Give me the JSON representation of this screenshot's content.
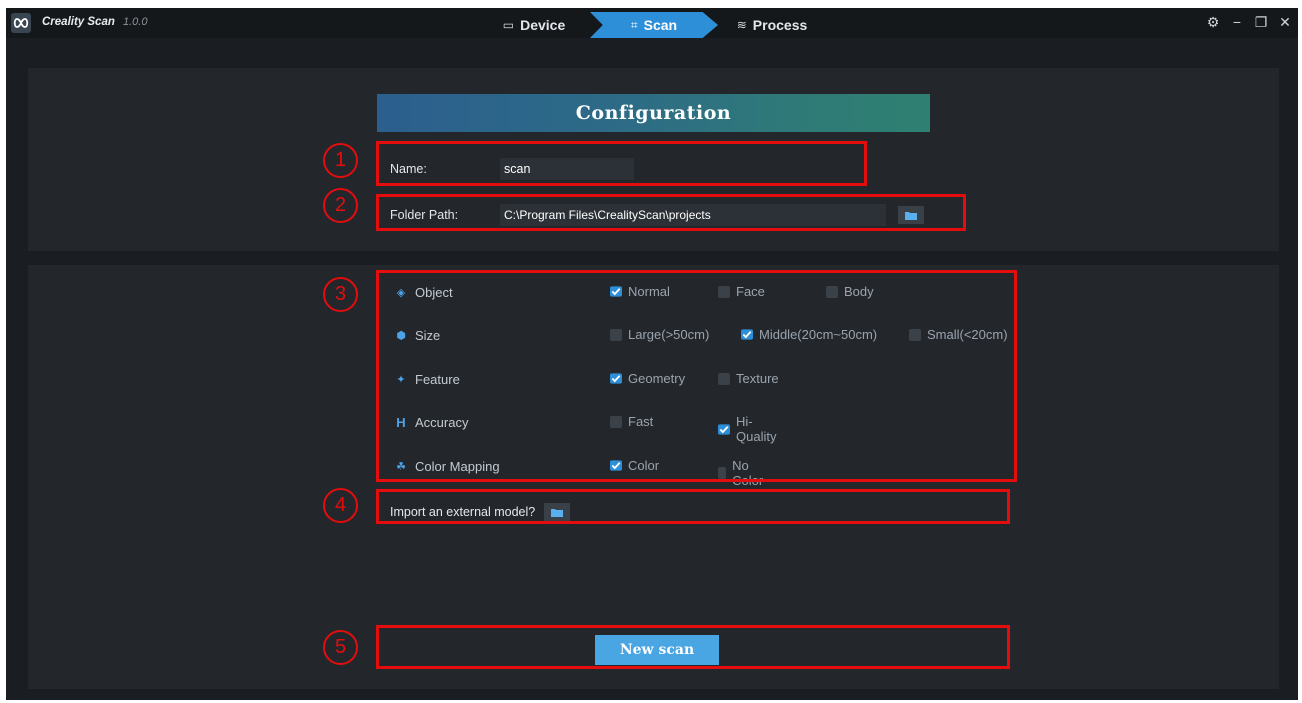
{
  "app": {
    "name": "Creality Scan",
    "version": "1.0.0"
  },
  "tabs": [
    {
      "label": "Device",
      "icon": "device-icon",
      "active": false
    },
    {
      "label": "Scan",
      "icon": "scan-icon",
      "active": true
    },
    {
      "label": "Process",
      "icon": "layers-icon",
      "active": false
    }
  ],
  "config": {
    "title": "Configuration",
    "name_label": "Name:",
    "name_value": "scan",
    "path_label": "Folder Path:",
    "path_value": "C:\\Program Files\\CrealityScan\\projects"
  },
  "options": [
    {
      "label": "Object",
      "icon": "object-icon",
      "choices": [
        {
          "label": "Normal",
          "checked": true
        },
        {
          "label": "Face",
          "checked": false
        },
        {
          "label": "Body",
          "checked": false
        }
      ]
    },
    {
      "label": "Size",
      "icon": "cube-icon",
      "choices": [
        {
          "label": "Large(>50cm)",
          "checked": false
        },
        {
          "label": "Middle(20cm~50cm)",
          "checked": true
        },
        {
          "label": "Small(<20cm)",
          "checked": false
        }
      ]
    },
    {
      "label": "Feature",
      "icon": "feature-icon",
      "choices": [
        {
          "label": "Geometry",
          "checked": true
        },
        {
          "label": "Texture",
          "checked": false
        }
      ]
    },
    {
      "label": "Accuracy",
      "icon": "accuracy-icon",
      "choices": [
        {
          "label": "Fast",
          "checked": false
        },
        {
          "label": "Hi-Quality",
          "checked": true
        }
      ]
    },
    {
      "label": "Color Mapping",
      "icon": "color-mapping-icon",
      "choices": [
        {
          "label": "Color",
          "checked": true
        },
        {
          "label": "No Color",
          "checked": false
        }
      ]
    }
  ],
  "import": {
    "label": "Import an external model?"
  },
  "new_scan": {
    "label": "New scan"
  },
  "annotations": [
    "1",
    "2",
    "3",
    "4",
    "5"
  ],
  "colors": {
    "accent": "#2d8fd8",
    "annotation": "#e30d0d",
    "panel": "#23272c",
    "background": "#1a1d21"
  }
}
